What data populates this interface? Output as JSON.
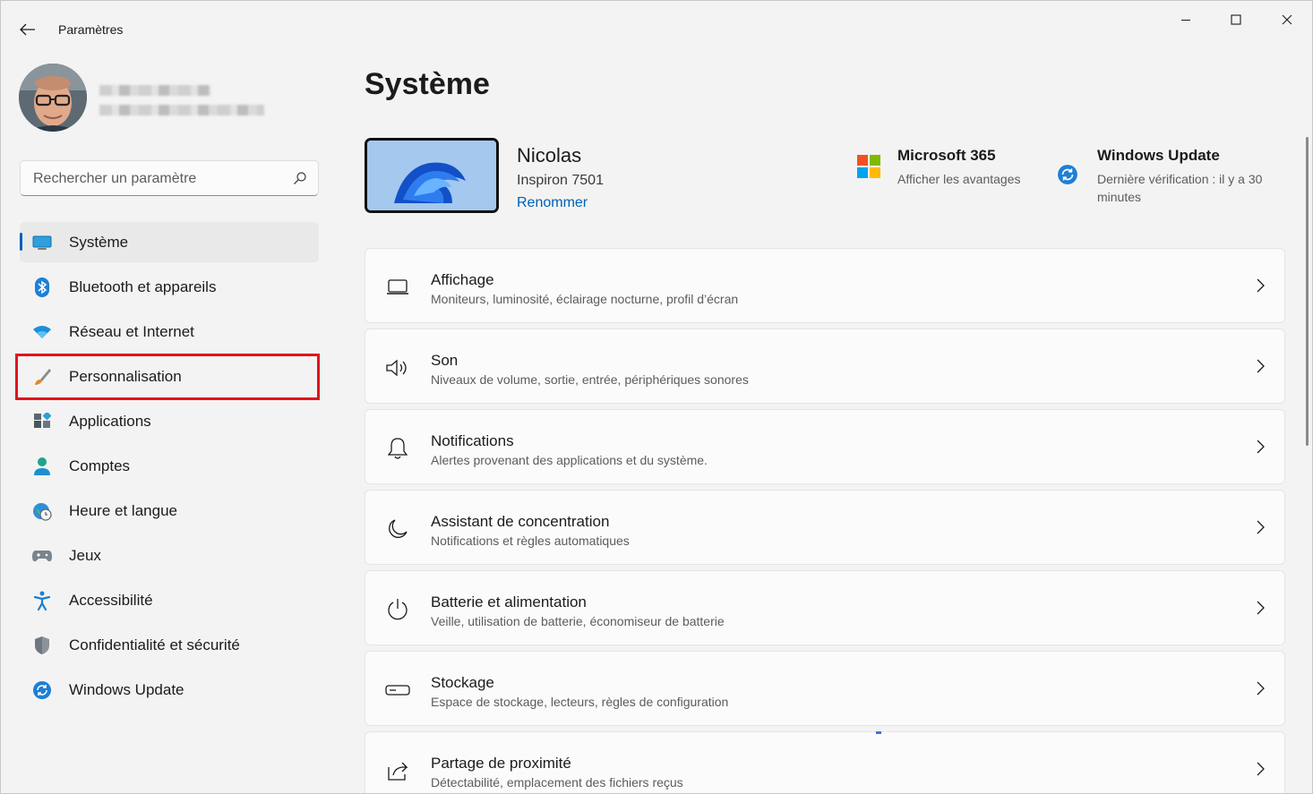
{
  "window": {
    "app_title": "Paramètres",
    "controls": {
      "minimize_icon": "minimize-icon",
      "maximize_icon": "maximize-icon",
      "close_icon": "close-icon"
    }
  },
  "search": {
    "placeholder": "Rechercher un paramètre",
    "value": ""
  },
  "sidebar": {
    "items": [
      {
        "label": "Système",
        "icon": "monitor-icon",
        "active": true
      },
      {
        "label": "Bluetooth et appareils",
        "icon": "bluetooth-icon"
      },
      {
        "label": "Réseau et Internet",
        "icon": "wifi-icon"
      },
      {
        "label": "Personnalisation",
        "icon": "brush-icon",
        "highlighted": true
      },
      {
        "label": "Applications",
        "icon": "apps-icon"
      },
      {
        "label": "Comptes",
        "icon": "person-icon"
      },
      {
        "label": "Heure et langue",
        "icon": "globe-clock-icon"
      },
      {
        "label": "Jeux",
        "icon": "gamepad-icon"
      },
      {
        "label": "Accessibilité",
        "icon": "accessibility-icon"
      },
      {
        "label": "Confidentialité et sécurité",
        "icon": "shield-icon"
      },
      {
        "label": "Windows Update",
        "icon": "update-icon"
      }
    ]
  },
  "main": {
    "page_title": "Système",
    "device": {
      "name": "Nicolas",
      "model": "Inspiron 7501",
      "rename_label": "Renommer"
    },
    "promos": [
      {
        "title": "Microsoft 365",
        "subtitle": "Afficher les avantages"
      },
      {
        "title": "Windows Update",
        "subtitle_line1": "Dernière vérification : il y a 30",
        "subtitle_line2": "minutes"
      }
    ],
    "cards": [
      {
        "title": "Affichage",
        "subtitle": "Moniteurs, luminosité, éclairage nocturne, profil d’écran",
        "icon": "display-icon"
      },
      {
        "title": "Son",
        "subtitle": "Niveaux de volume, sortie, entrée, périphériques sonores",
        "icon": "speaker-icon"
      },
      {
        "title": "Notifications",
        "subtitle": "Alertes provenant des applications et du système.",
        "icon": "bell-icon"
      },
      {
        "title": "Assistant de concentration",
        "subtitle": "Notifications et règles automatiques",
        "icon": "moon-icon"
      },
      {
        "title": "Batterie et alimentation",
        "subtitle": "Veille, utilisation de batterie, économiseur de batterie",
        "icon": "power-icon"
      },
      {
        "title": "Stockage",
        "subtitle": "Espace de stockage, lecteurs, règles de configuration",
        "icon": "storage-icon"
      },
      {
        "title": "Partage de proximité",
        "subtitle": "Détectabilité, emplacement des fichiers reçus",
        "icon": "share-icon"
      }
    ]
  },
  "colors": {
    "accent": "#005fb8",
    "highlight_box": "#e3141b",
    "background": "#f3f3f3",
    "card": "#fbfbfb"
  }
}
